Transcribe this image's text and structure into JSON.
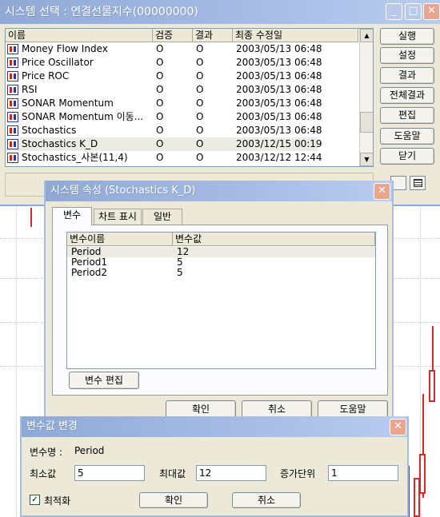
{
  "main_window": {
    "title": "시스템 선택 : 연결선물지수(00000000)",
    "columns": [
      "이름",
      "검증",
      "결과",
      "최종 수정일"
    ],
    "rows": [
      {
        "name": "Money Flow Index",
        "verify": "O",
        "result": "O",
        "modified": "2003/05/13  06:48"
      },
      {
        "name": "Price Oscillator",
        "verify": "O",
        "result": "O",
        "modified": "2003/05/13  06:48"
      },
      {
        "name": "Price ROC",
        "verify": "O",
        "result": "O",
        "modified": "2003/05/13  06:48"
      },
      {
        "name": "RSI",
        "verify": "O",
        "result": "O",
        "modified": "2003/05/13  06:48"
      },
      {
        "name": "SONAR Momentum",
        "verify": "O",
        "result": "O",
        "modified": "2003/05/13  06:48"
      },
      {
        "name": "SONAR Momentum 이동...",
        "verify": "O",
        "result": "O",
        "modified": "2003/05/13  06:48"
      },
      {
        "name": "Stochastics",
        "verify": "O",
        "result": "O",
        "modified": "2003/05/13  06:48"
      },
      {
        "name": "Stochastics K_D",
        "verify": "O",
        "result": "O",
        "modified": "2003/12/15  00:19"
      },
      {
        "name": "Stochastics_사본(11,4)",
        "verify": "O",
        "result": "O",
        "modified": "2003/12/12  12:44"
      }
    ],
    "buttons": [
      "실행",
      "설정",
      "결과",
      "전체결과",
      "편집",
      "도움말",
      "닫기"
    ]
  },
  "props_dialog": {
    "title": "시스템 속성 (Stochastics K_D)",
    "tabs": [
      "변수",
      "차트 표시",
      "일반"
    ],
    "columns": [
      "변수이름",
      "변수값"
    ],
    "variables": [
      {
        "name": "Period",
        "value": "12"
      },
      {
        "name": "Period1",
        "value": "5"
      },
      {
        "name": "Period2",
        "value": "5"
      }
    ],
    "edit_button": "변수 편집",
    "ok": "확인",
    "cancel": "취소",
    "help": "도움말"
  },
  "value_dialog": {
    "title": "변수값 변경",
    "var_label": "변수명 :",
    "var_name": "Period",
    "min_label": "최소값",
    "min_value": "5",
    "max_label": "최대값",
    "max_value": "12",
    "step_label": "증가단위",
    "step_value": "1",
    "optimize_label": "최적화",
    "optimize_checked": "✓",
    "ok": "확인",
    "cancel": "취소"
  }
}
